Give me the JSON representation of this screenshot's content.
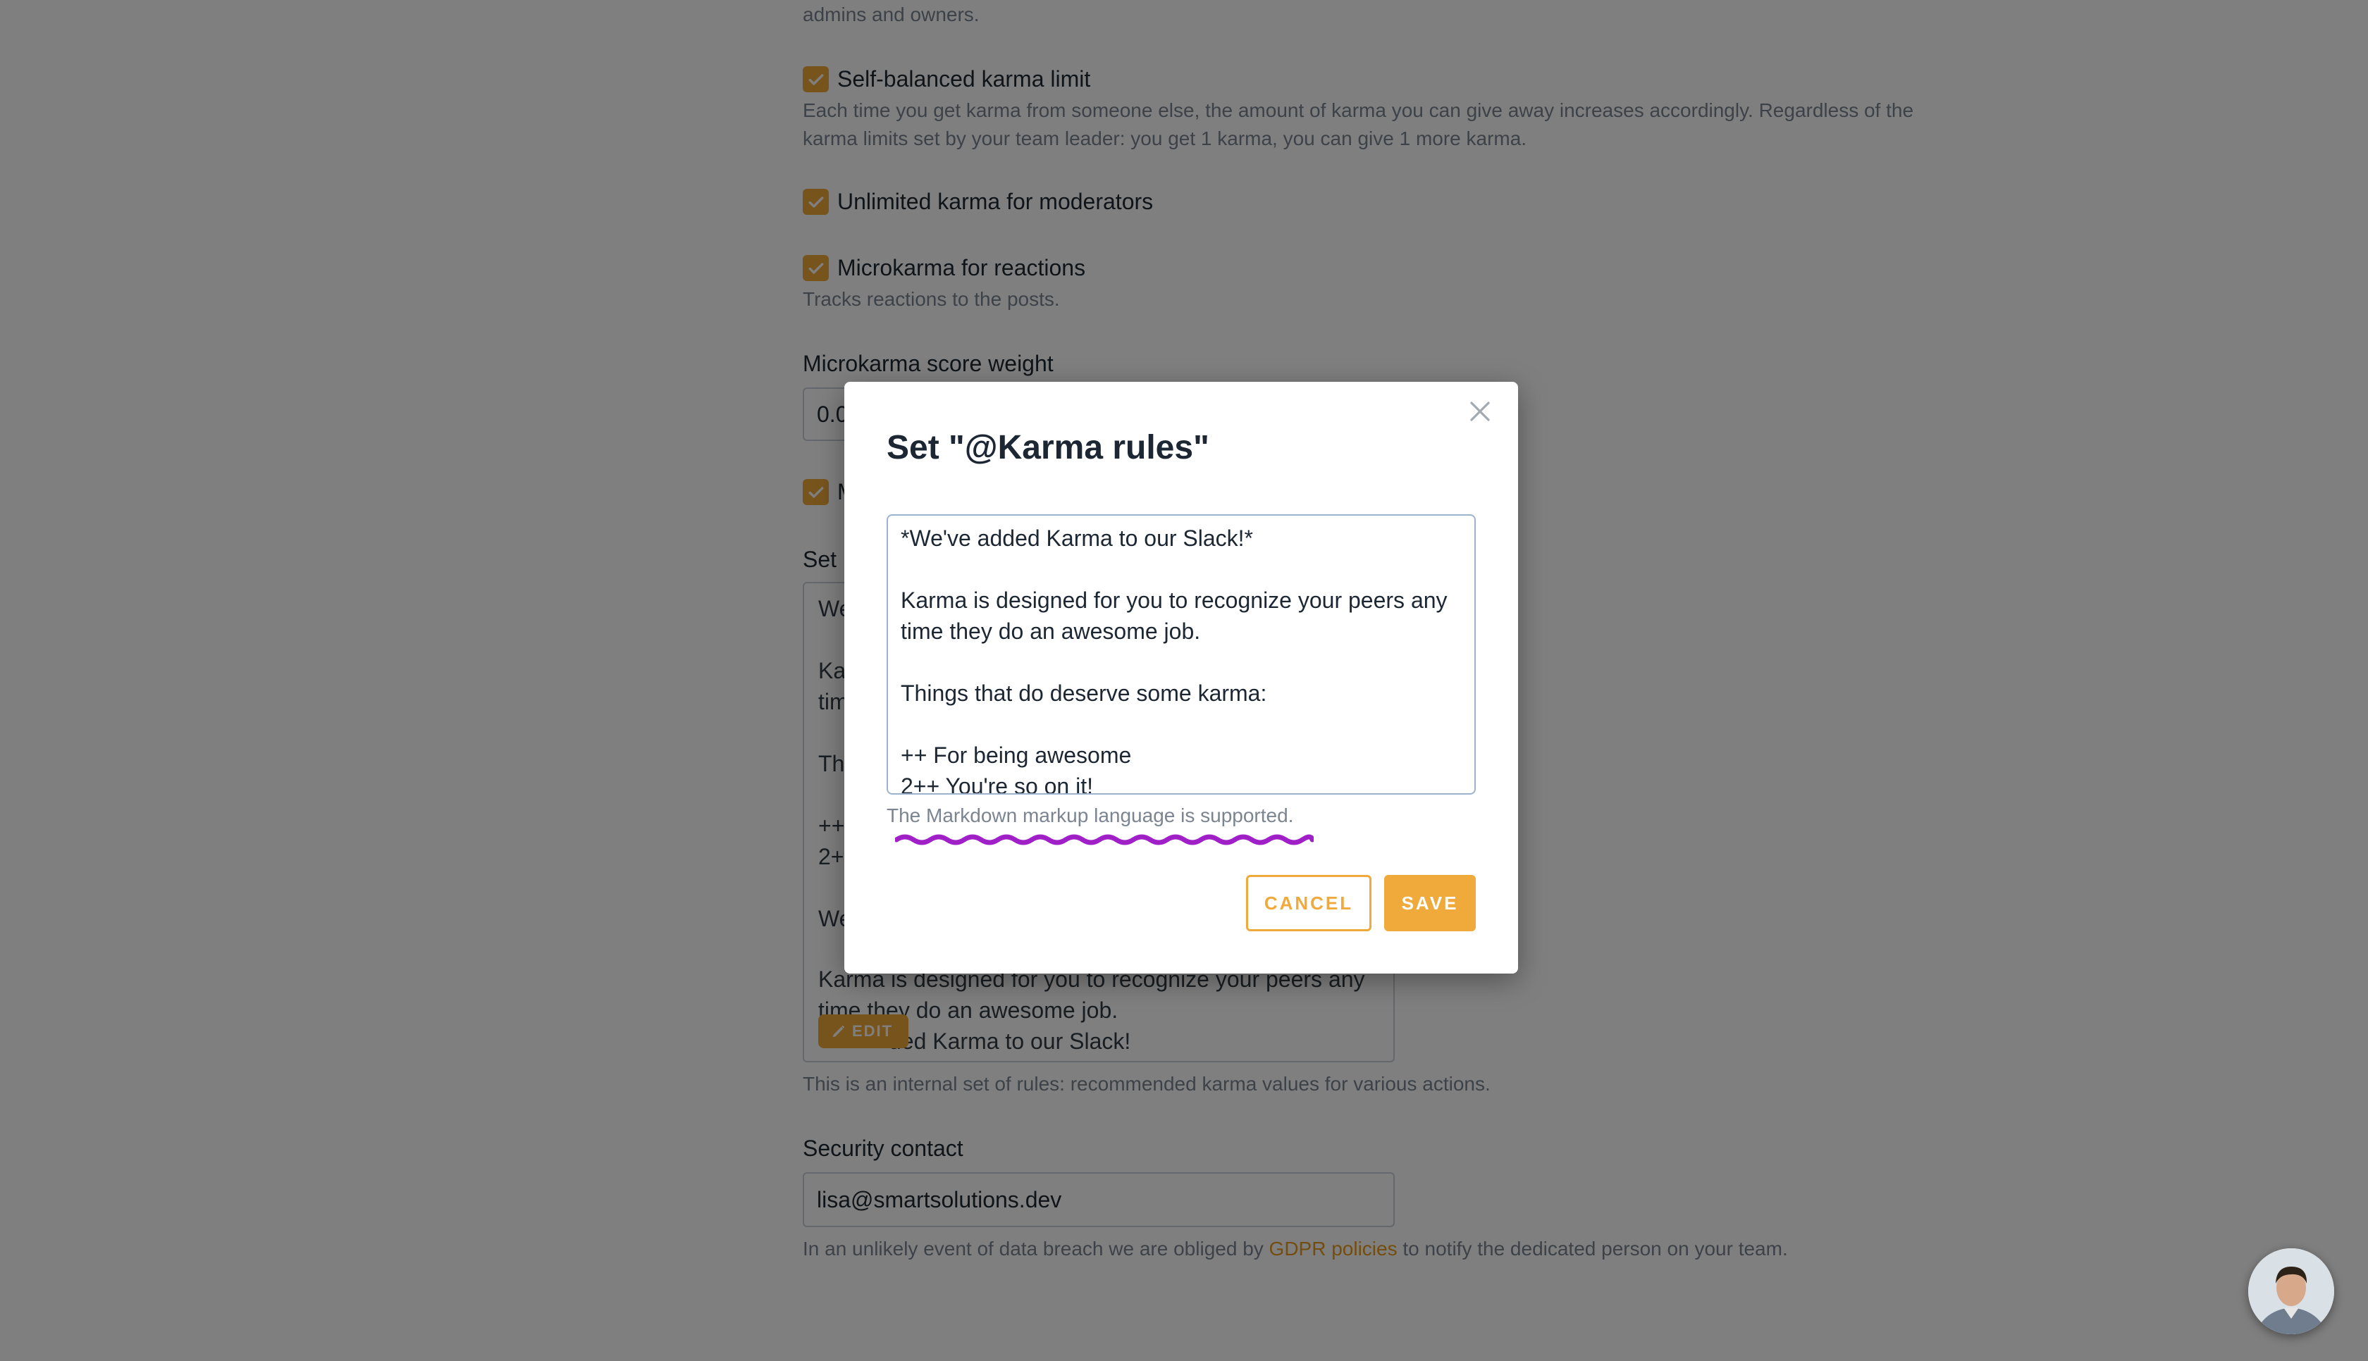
{
  "settings": {
    "admins_note": "admins and owners.",
    "self_balanced": {
      "label": "Self-balanced karma limit",
      "desc_line1": "Each time you get karma from someone else, the amount of karma you can give away increases accordingly. Regardless of the",
      "desc_line2": "karma limits set by your team leader: you get 1 karma, you can give 1 more karma."
    },
    "unlimited_moderators": {
      "label": "Unlimited karma for moderators"
    },
    "microkarma_reactions": {
      "label": "Microkarma for reactions",
      "desc": "Tracks reactions to the posts."
    },
    "microkarma_weight": {
      "label": "Microkarma score weight",
      "value": "0.0"
    },
    "fifth_checkbox": {
      "label": "M"
    },
    "rules_label": "Set",
    "rules_box": {
      "lines": [
        "We",
        "",
        "Ka",
        "tim",
        "",
        "Th",
        "",
        "++",
        "2+",
        "",
        "We",
        "",
        "Karma is designed for you to recognize your peers any",
        "time they do an awesome job.",
        "ded Karma to our Slack!"
      ],
      "edit_label": "EDIT",
      "note": "This is an internal set of rules: recommended karma values for various actions."
    },
    "security_contact": {
      "label": "Security contact",
      "value": "lisa@smartsolutions.dev",
      "note_before": "In an unlikely event of data breach we are obliged by ",
      "note_link": "GDPR policies",
      "note_after": " to notify the dedicated person on your team."
    }
  },
  "modal": {
    "title": "Set \"@Karma rules\"",
    "textarea_value": "*We've added Karma to our Slack!*\n\nKarma is designed for you to recognize your peers any time they do an awesome job.\n\nThings that do deserve some karma:\n\n++ For being awesome\n2++ You're so on it!",
    "hint": "The Markdown markup language is supported.",
    "cancel_label": "CANCEL",
    "save_label": "SAVE"
  },
  "colors": {
    "accent": "#f0a93b",
    "link": "#e79a1e",
    "annotation": "#a020c8",
    "overlay": "rgba(0,0,0,0.5)"
  },
  "icons": [
    "check-icon",
    "close-icon",
    "pencil-icon",
    "avatar"
  ]
}
